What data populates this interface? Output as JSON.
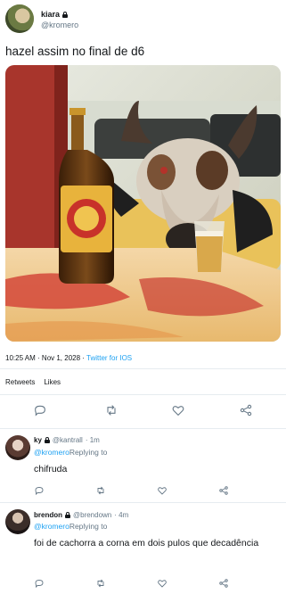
{
  "tweet": {
    "display_name": "kiara",
    "handle": "@kromero",
    "text": "hazel assim no final de d6",
    "timestamp": "10:25 AM · Nov 1, 2028 · ",
    "source": "Twitter for IOS",
    "stats": {
      "retweets_label": "Retweets",
      "likes_label": "Likes"
    },
    "media_icon": "photo"
  },
  "actions": [
    "reply-icon",
    "retweet-icon",
    "like-icon",
    "share-icon"
  ],
  "replies": [
    {
      "display_name": "ky",
      "handle": "@kantrall",
      "time": "· 1m",
      "replying_mention": "@kromero",
      "replying_text": "Replying to",
      "text": "chifruda"
    },
    {
      "display_name": "brendon",
      "handle": "@brendown",
      "time": "· 4m",
      "replying_mention": "@kromero",
      "replying_text": "Replying to",
      "text": "foi de cachorra a corna em dois pulos que decadência"
    }
  ],
  "colors": {
    "accent": "#1da1f2",
    "muted": "#657786",
    "text": "#14171a",
    "divider": "#e6ecf0"
  }
}
